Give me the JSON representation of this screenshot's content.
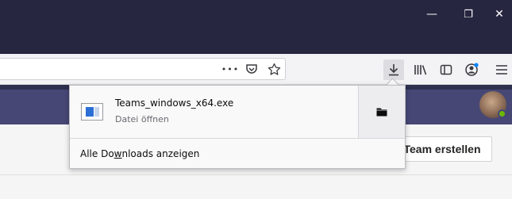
{
  "window_controls": {
    "minimize_glyph": "—",
    "restore_glyph": "❐",
    "close_glyph": "✕"
  },
  "toolbar": {
    "page_actions_glyph": "•••"
  },
  "downloads_panel": {
    "item": {
      "filename": "Teams_windows_x64.exe",
      "status": "Datei öffnen"
    },
    "show_all": {
      "before_accesskey": "Alle Do",
      "accesskey": "w",
      "after_accesskey": "nloads anzeigen"
    }
  },
  "page": {
    "create_team_button": "Team erstellen",
    "avatar_status_color": "#6bb700"
  },
  "colors": {
    "titlebar": "#262640",
    "teams_header": "#464775",
    "accent_blue": "#0a84ff"
  },
  "icons": {
    "library": "library-icon",
    "sidebar": "sidebar-icon",
    "account": "account-icon",
    "menu": "hamburger-menu-icon",
    "downloads": "download-arrow-icon",
    "pocket": "pocket-icon",
    "bookmark": "bookmark-star-icon",
    "folder": "folder-icon",
    "file": "exe-file-icon"
  }
}
